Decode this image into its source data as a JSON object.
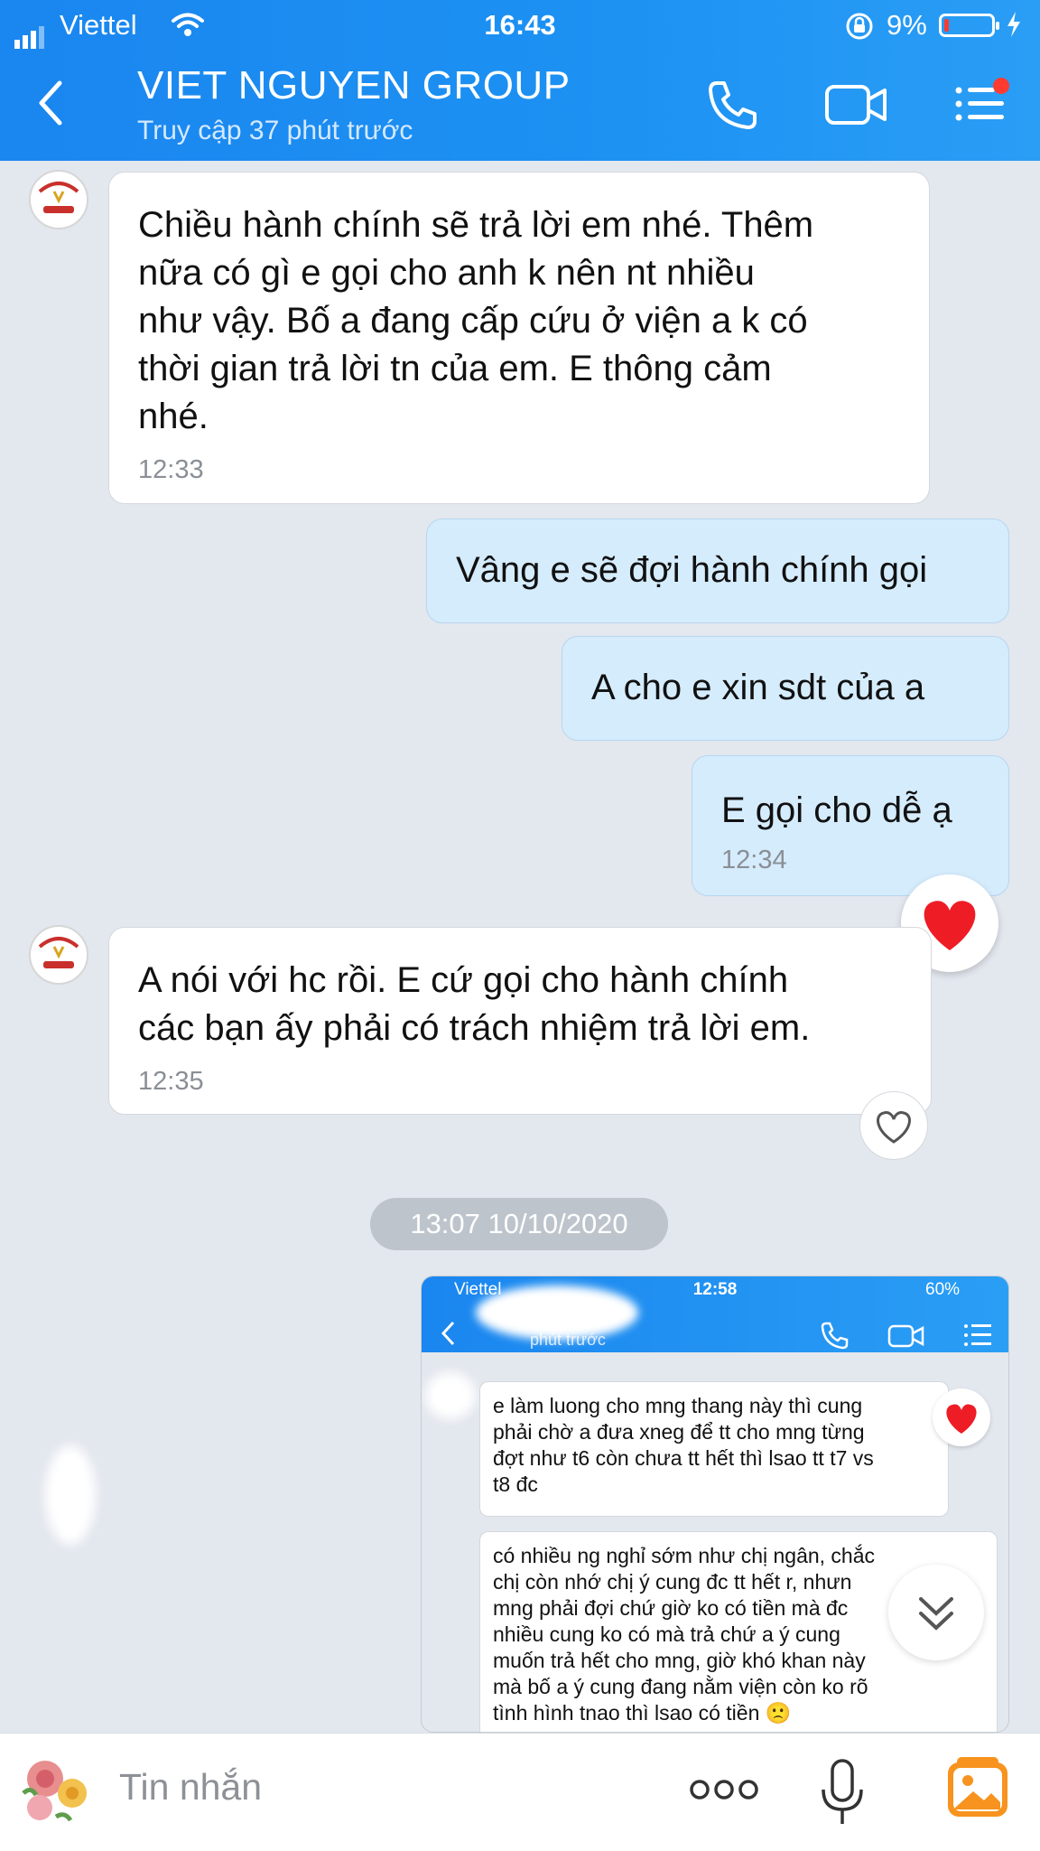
{
  "status_bar": {
    "carrier": "Viettel",
    "time": "16:43",
    "battery": "9%"
  },
  "header": {
    "title": "VIET NGUYEN GROUP",
    "subtitle": "Truy cập 37 phút trước",
    "icons": [
      "back-icon",
      "phone-icon",
      "video-icon",
      "menu-icon"
    ]
  },
  "messages": [
    {
      "direction": "in",
      "text": "Chiều hành chính sẽ trả lời em nhé. Thêm\nnữa có gì e gọi cho anh k nên nt nhiều\nnhư vậy. Bố a đang cấp cứu ở viện a k có\nthời gian trả lời tn của em. E thông cảm\nnhé.",
      "time": "12:33"
    },
    {
      "direction": "out",
      "text": "Vâng e sẽ đợi hành chính gọi"
    },
    {
      "direction": "out",
      "text": "A cho e xin sdt của a"
    },
    {
      "direction": "out",
      "text": "E gọi cho dễ ạ",
      "time": "12:34",
      "reaction": "heart-icon"
    },
    {
      "direction": "in",
      "text": "A nói với hc rồi. E cứ gọi cho hành chính\ncác bạn ấy phải có trách nhiệm trả lời em.",
      "time": "12:35"
    }
  ],
  "date_separator": "13:07 10/10/2020",
  "shared_image": {
    "status_carrier": "Viettel",
    "status_time": "12:58",
    "status_battery": "60%",
    "subtitle": "phút trước",
    "message_1": "e làm luong cho mng thang này thì cung\nphải chờ a đưa xneg để tt cho mng từng\nđợt như t6 còn chưa tt hết thì lsao tt t7 vs\nt8 đc",
    "message_2": "có nhiều ng nghỉ sớm như chị ngân, chắc\nchị còn nhớ chị ý cung đc tt hết r, nhưn\nmng phải đợi chứ giờ ko có tiền mà đc\nnhiều cung ko có mà trả chứ a ý cung\nmuốn trả hết cho mng, giờ khó khan này\nmà bố a ý cung đang nằm viện còn ko rõ\ntình hình tnao thì lsao có tiền 🙁"
  },
  "input": {
    "placeholder": "Tin nhắn"
  },
  "colors": {
    "header": "#1d8ff0",
    "incoming_bubble": "#ffffff",
    "outgoing_bubble": "#d5ecfd",
    "background": "#e3e7ee",
    "reaction": "#ee1c25"
  }
}
